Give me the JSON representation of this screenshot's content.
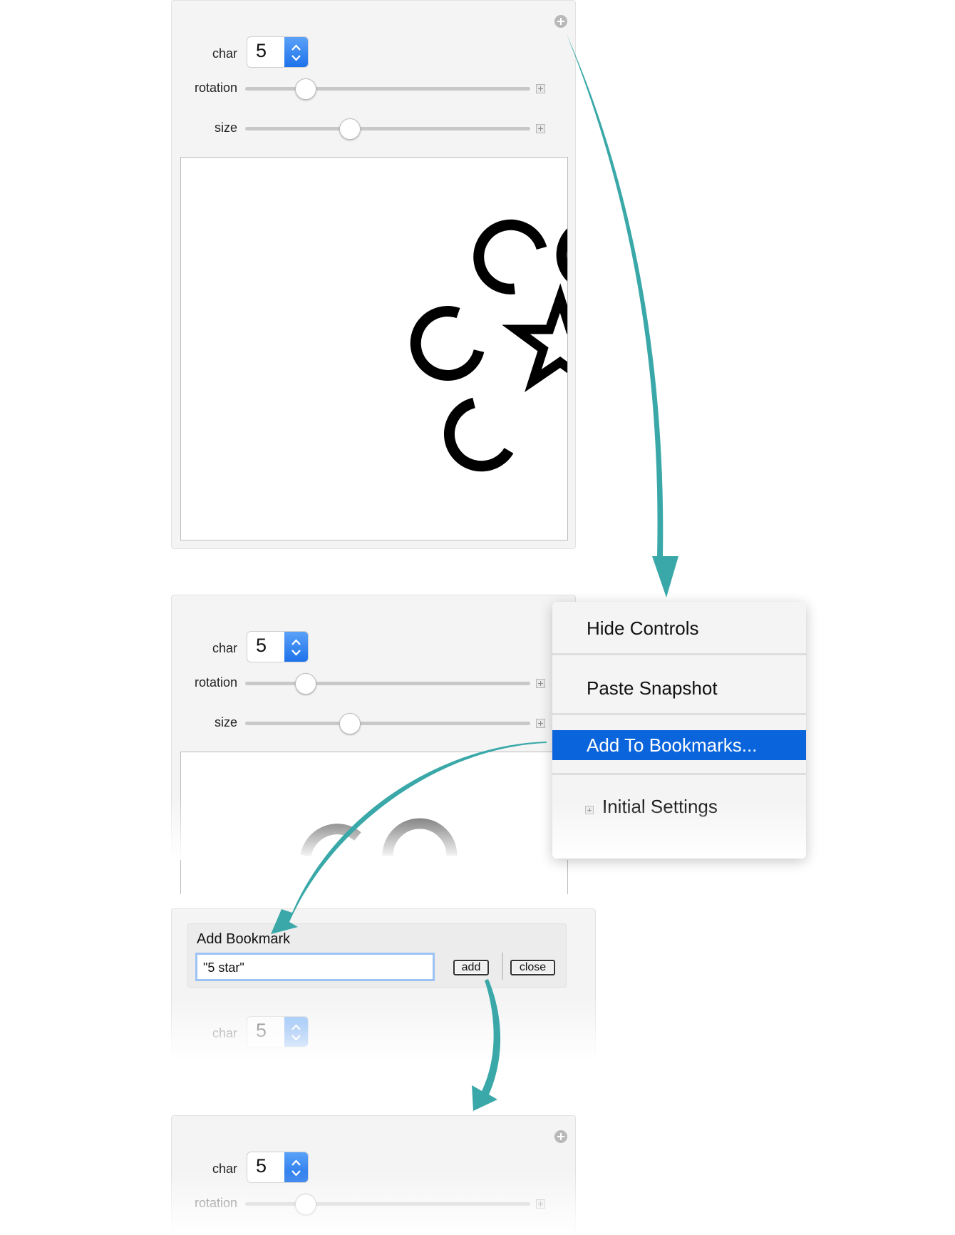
{
  "panel1": {
    "char_label": "char",
    "char_value": "5",
    "rotation_label": "rotation",
    "size_label": "size",
    "rotation_value": 0.21,
    "size_value": 0.37
  },
  "panel2": {
    "char_label": "char",
    "char_value": "5",
    "rotation_label": "rotation",
    "size_label": "size"
  },
  "context_menu": {
    "items": [
      "Hide Controls",
      "Paste Snapshot",
      "Add To Bookmarks...",
      "Initial Settings"
    ],
    "highlighted": "Add To Bookmarks..."
  },
  "bookmark_dialog": {
    "title": "Add Bookmark",
    "input_value": "\"5 star\"",
    "add_label": "add",
    "close_label": "close",
    "char_label": "char",
    "char_value": "5"
  },
  "panel4": {
    "char_label": "char",
    "char_value": "5",
    "rotation_label": "rotation"
  },
  "colors": {
    "arrow": "#3aa8a8",
    "highlight": "#0a64db",
    "stepper": "#1e72ea"
  }
}
